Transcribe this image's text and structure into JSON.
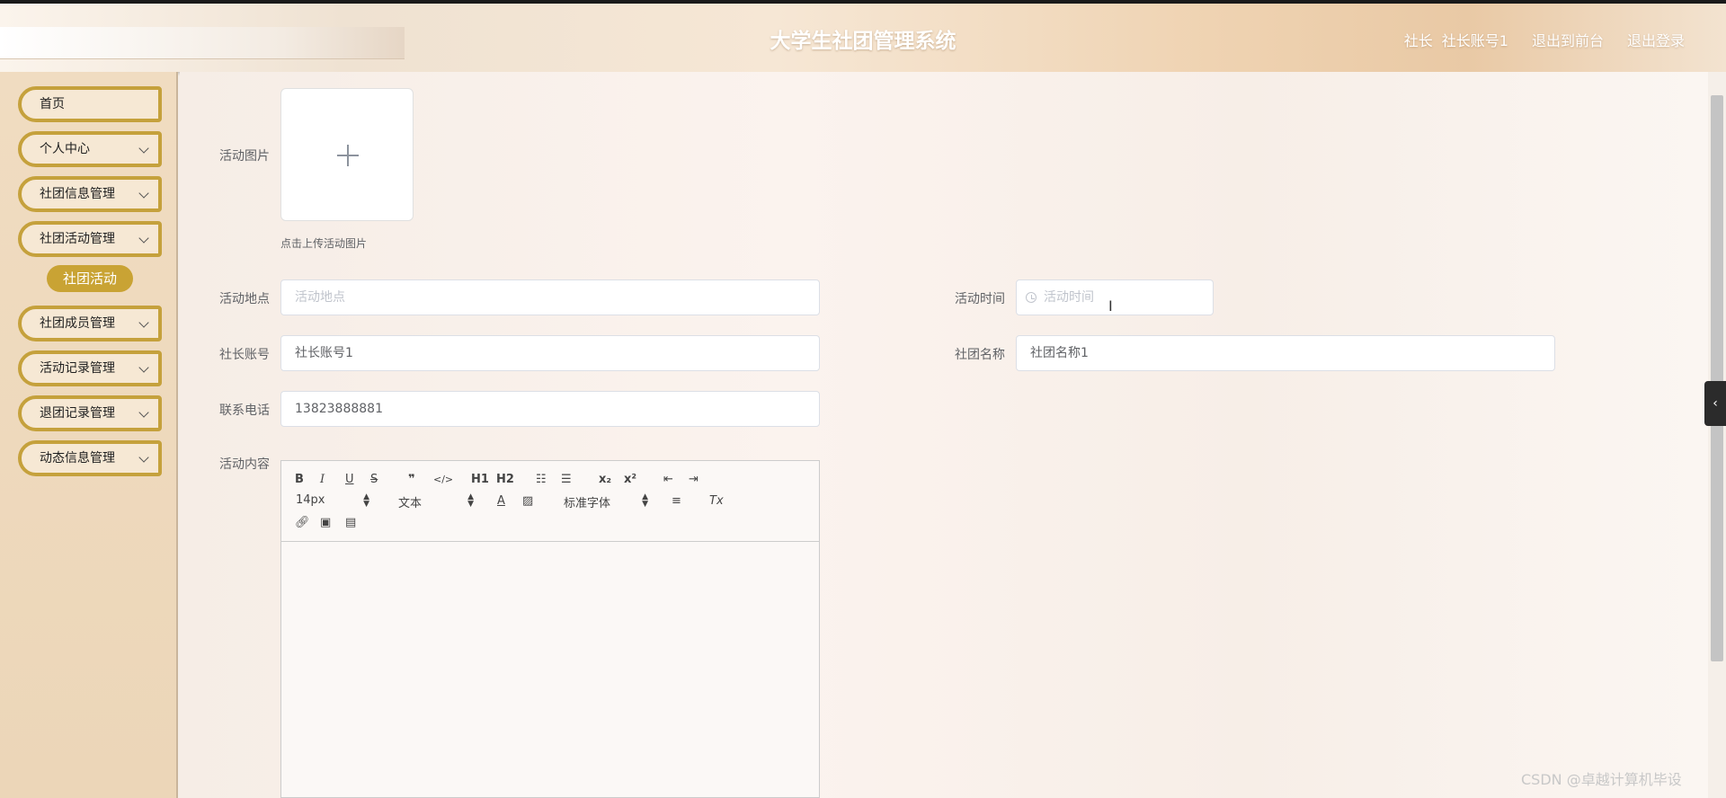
{
  "header": {
    "title": "大学生社团管理系统",
    "role": "社长",
    "account": "社长账号1",
    "to_front": "退出到前台",
    "logout": "退出登录"
  },
  "sidebar": {
    "items": [
      {
        "label": "首页"
      },
      {
        "label": "个人中心"
      },
      {
        "label": "社团信息管理"
      },
      {
        "label": "社团活动管理"
      },
      {
        "label": "社团成员管理"
      },
      {
        "label": "活动记录管理"
      },
      {
        "label": "退团记录管理"
      },
      {
        "label": "动态信息管理"
      }
    ],
    "active_sub": "社团活动"
  },
  "form": {
    "image_label": "活动图片",
    "upload_tip": "点击上传活动图片",
    "location_label": "活动地点",
    "location_placeholder": "活动地点",
    "time_label": "活动时间",
    "time_placeholder": "活动时间",
    "leader_label": "社长账号",
    "leader_value": "社长账号1",
    "club_label": "社团名称",
    "club_value": "社团名称1",
    "phone_label": "联系电话",
    "phone_value": "13823888881",
    "content_label": "活动内容"
  },
  "editor": {
    "bold": "B",
    "italic": "I",
    "underline": "U",
    "strike": "S",
    "quote": "❞",
    "code": "</>",
    "h1": "H1",
    "h2": "H2",
    "sub": "x₂",
    "sup": "x²",
    "font_size": "14px",
    "text_style": "文本",
    "font_family": "标准字体",
    "clear": "Tx"
  },
  "watermark": "CSDN @卓越计算机毕设"
}
